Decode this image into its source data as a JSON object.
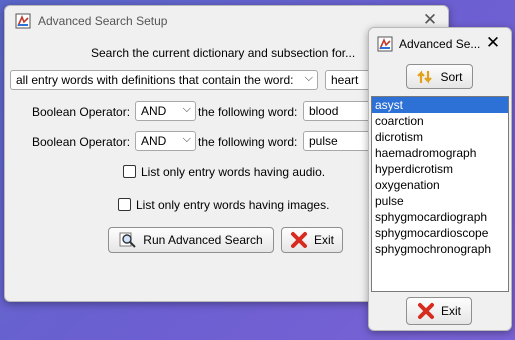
{
  "colors": {
    "accent": "#2e71d6",
    "background": "#6c5fd1",
    "window": "#f0f0f0"
  },
  "main_window": {
    "title": "Advanced Search Setup",
    "close_icon": "close-icon",
    "prompt": "Search the current dictionary and subsection for...",
    "scope_select": {
      "selected": "all entry words with definitions that contain the word:"
    },
    "word1": "heart",
    "row2": {
      "label": "Boolean Operator:",
      "operator": "AND",
      "following_label": "the following word:",
      "word": "blood"
    },
    "row3": {
      "label": "Boolean Operator:",
      "operator": "AND",
      "following_label": "the following word:",
      "word": "pulse"
    },
    "audio_checkbox": {
      "label": "List only entry words having audio.",
      "checked": false
    },
    "images_checkbox": {
      "label": "List only entry words having images.",
      "checked": false
    },
    "run_button": "Run Advanced Search",
    "exit_button": "Exit"
  },
  "results_window": {
    "title": "Advanced Se...",
    "sort_button": "Sort",
    "items": [
      "asyst",
      "coarction",
      "dicrotism",
      "haemadromograph",
      "hyperdicrotism",
      "oxygenation",
      "pulse",
      "sphygmocardiograph",
      "sphygmocardioscope",
      "sphygmochronograph"
    ],
    "selected_index": 0,
    "exit_button": "Exit"
  }
}
